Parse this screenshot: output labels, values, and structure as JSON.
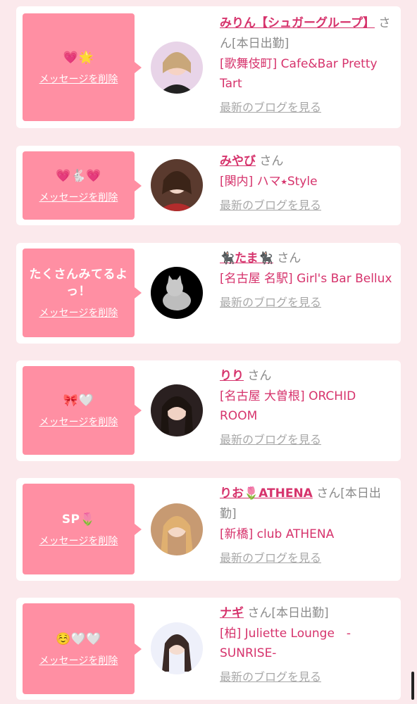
{
  "san_label": "さん",
  "delete_label": "メッセージを削除",
  "blog_label": "最新のブログを見る",
  "cards": [
    {
      "message": "💗🌟",
      "name": "みりん【シュガーグループ】",
      "badge": "[本日出勤]",
      "shop": "[歌舞伎町] Cafe&Bar Pretty Tart"
    },
    {
      "message": "💗🐇💗",
      "name": "みやび",
      "badge": "",
      "shop": "[関内] ハマ⭑Style"
    },
    {
      "message": "たくさんみてるよっ！",
      "name": "🐈‍⬛たま🐈‍⬛",
      "badge": "",
      "shop": "[名古屋 名駅] Girl's Bar Bellux"
    },
    {
      "message": "🎀🤍",
      "name": "りり",
      "badge": "",
      "shop": "[名古屋 大曽根] ORCHID ROOM"
    },
    {
      "message": "SP🌷",
      "name": "りお🌷ATHENA",
      "badge": "[本日出勤]",
      "shop": "[新橋] club ATHENA"
    },
    {
      "message": "☺️🤍🤍",
      "name": "ナギ",
      "badge": "[本日出勤]",
      "shop": "[柏] Juliette Lounge　-SUNRISE-"
    }
  ]
}
